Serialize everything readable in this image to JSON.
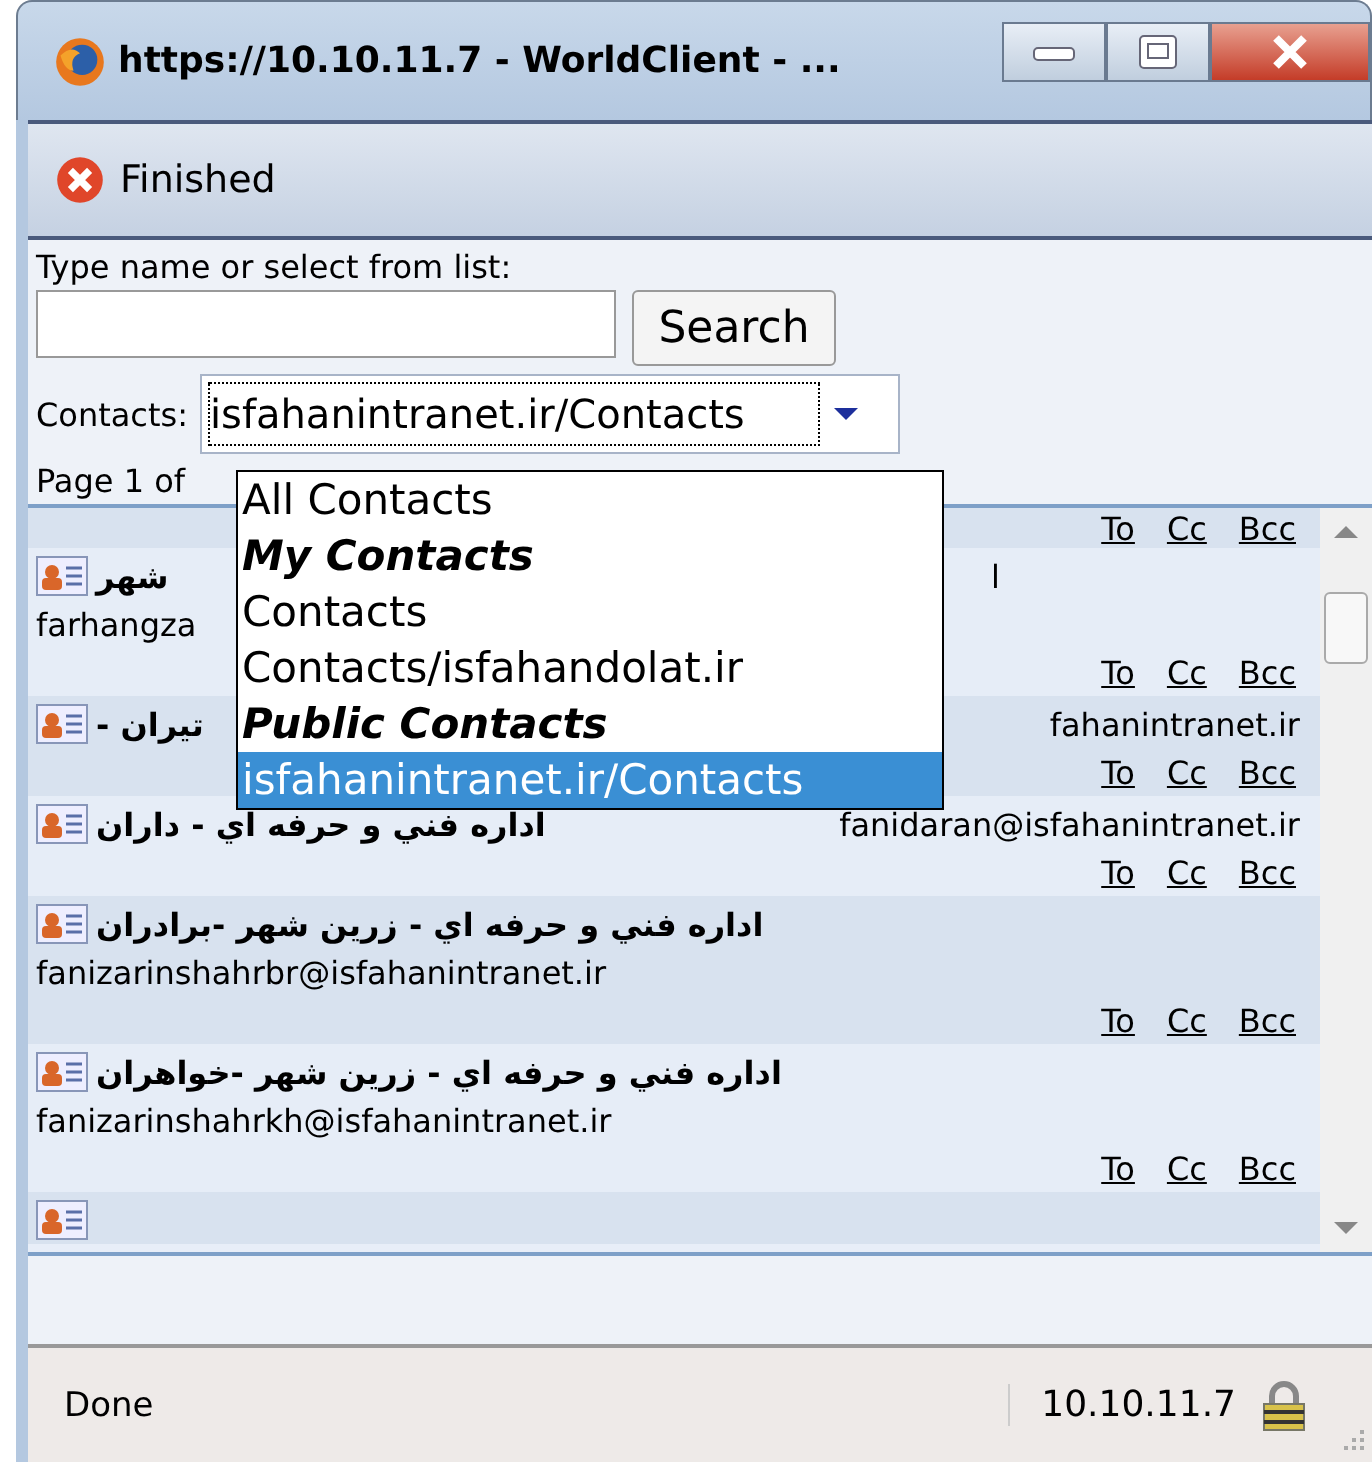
{
  "window": {
    "title": "https://10.10.11.7 - WorldClient - ..."
  },
  "toolbar": {
    "finished_label": "Finished"
  },
  "search": {
    "label": "Type name or select from list:",
    "button": "Search"
  },
  "contacts_select": {
    "label": "Contacts:",
    "value": "isfahanintranet.ir/Contacts",
    "expanded": true,
    "options": [
      {
        "label": "All Contacts",
        "kind": "item",
        "selected": false
      },
      {
        "label": "My Contacts",
        "kind": "group",
        "selected": false
      },
      {
        "label": "Contacts",
        "kind": "item",
        "selected": false
      },
      {
        "label": "Contacts/isfahandolat.ir",
        "kind": "item",
        "selected": false
      },
      {
        "label": "Public Contacts",
        "kind": "group",
        "selected": false
      },
      {
        "label": "isfahanintranet.ir/Contacts",
        "kind": "item",
        "selected": true
      }
    ]
  },
  "pager": "Page 1 of",
  "contacts": [
    {
      "kind": "links",
      "links": [
        "To",
        "Cc",
        "Bcc"
      ]
    },
    {
      "kind": "stacked",
      "name": "شهر",
      "fragment": "ا",
      "email": "farhangza",
      "links": [
        "To",
        "Cc",
        "Bcc"
      ]
    },
    {
      "kind": "inline",
      "name": "تيران -",
      "email": "fahanintranet.ir",
      "links": [
        "To",
        "Cc",
        "Bcc"
      ]
    },
    {
      "kind": "inline",
      "name": "اداره فني و حرفه اي - داران",
      "email": "fanidaran@isfahanintranet.ir",
      "links": [
        "To",
        "Cc",
        "Bcc"
      ]
    },
    {
      "kind": "stacked",
      "name": "اداره فني و حرفه اي - زرين شهر -برادران",
      "email": "fanizarinshahrbr@isfahanintranet.ir",
      "links": [
        "To",
        "Cc",
        "Bcc"
      ]
    },
    {
      "kind": "stacked",
      "name": "اداره فني و حرفه اي - زرين شهر -خواهران",
      "email": "fanizarinshahrkh@isfahanintranet.ir",
      "links": [
        "To",
        "Cc",
        "Bcc"
      ]
    },
    {
      "kind": "partial"
    }
  ],
  "status_bar": {
    "text": "Done",
    "host": "10.10.11.7"
  }
}
